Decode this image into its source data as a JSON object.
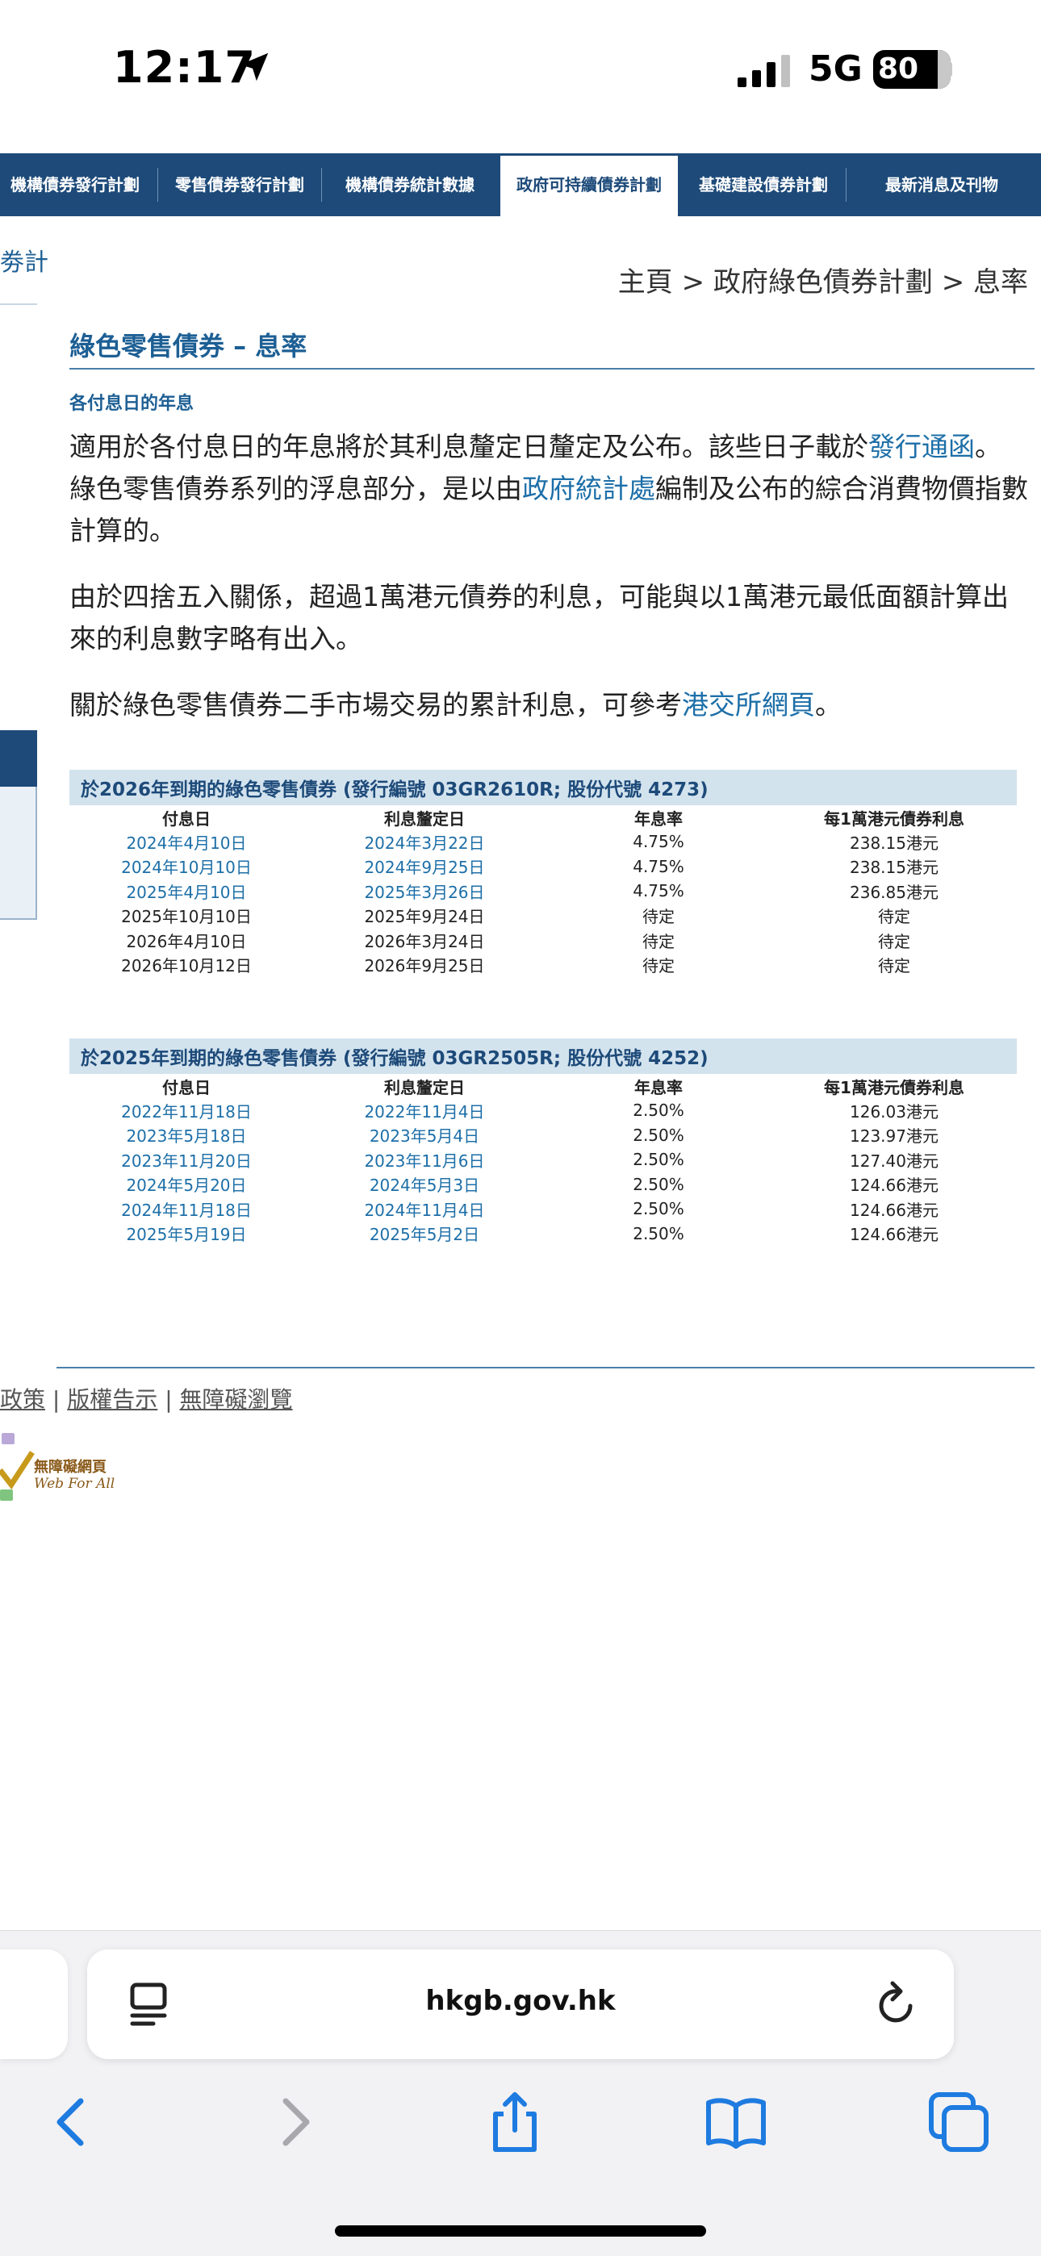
{
  "status_bar": {
    "time": "12:17",
    "network": "5G",
    "battery": "80"
  },
  "nav": {
    "tabs": [
      {
        "label": "機構債券發行計劃",
        "active": false
      },
      {
        "label": "零售債券發行計劃",
        "active": false
      },
      {
        "label": "機構債券統計數據",
        "active": false
      },
      {
        "label": "政府可持續債券計劃",
        "active": true
      },
      {
        "label": "基礎建設債券計劃",
        "active": false
      },
      {
        "label": "最新消息及刊物",
        "active": false
      }
    ]
  },
  "sidebar_fragment": {
    "text": "劵計"
  },
  "breadcrumb": {
    "text": "主頁 > 政府綠色債券計劃 > 息率"
  },
  "page": {
    "title": "綠色零售債券 – 息率",
    "section_title": "各付息日的年息",
    "para1": {
      "t1": "適用於各付息日的年息將於其利息釐定日釐定及公布。該些日子載於",
      "link1": "發行通函",
      "t2": "。 綠色零售債券系列的浮息部分，是以由",
      "link2": "政府統計處",
      "t3": "編制及公布的綜合消費物價指數計算的。"
    },
    "para2": "由於四捨五入關係，超過1萬港元債券的利息，可能與以1萬港元最低面額計算出來的利息數字略有出入。",
    "para3": {
      "t1": "關於綠色零售債券二手市場交易的累計利息，可參考",
      "link1": "港交所網頁",
      "t2": "。"
    }
  },
  "tables": [
    {
      "caption": "於2026年到期的綠色零售債券 (發行編號 03GR2610R; 股份代號 4273)",
      "headers": [
        "付息日",
        "利息釐定日",
        "年息率",
        "每1萬港元債券利息"
      ],
      "rows": [
        {
          "pay": "2024年4月10日",
          "fix": "2024年3月22日",
          "rate": "4.75%",
          "interest": "238.15港元",
          "linked": true
        },
        {
          "pay": "2024年10月10日",
          "fix": "2024年9月25日",
          "rate": "4.75%",
          "interest": "238.15港元",
          "linked": true
        },
        {
          "pay": "2025年4月10日",
          "fix": "2025年3月26日",
          "rate": "4.75%",
          "interest": "236.85港元",
          "linked": true
        },
        {
          "pay": "2025年10月10日",
          "fix": "2025年9月24日",
          "rate": "待定",
          "interest": "待定",
          "linked": false
        },
        {
          "pay": "2026年4月10日",
          "fix": "2026年3月24日",
          "rate": "待定",
          "interest": "待定",
          "linked": false
        },
        {
          "pay": "2026年10月12日",
          "fix": "2026年9月25日",
          "rate": "待定",
          "interest": "待定",
          "linked": false
        }
      ]
    },
    {
      "caption": "於2025年到期的綠色零售債券 (發行編號 03GR2505R; 股份代號 4252)",
      "headers": [
        "付息日",
        "利息釐定日",
        "年息率",
        "每1萬港元債券利息"
      ],
      "rows": [
        {
          "pay": "2022年11月18日",
          "fix": "2022年11月4日",
          "rate": "2.50%",
          "interest": "126.03港元",
          "linked": true
        },
        {
          "pay": "2023年5月18日",
          "fix": "2023年5月4日",
          "rate": "2.50%",
          "interest": "123.97港元",
          "linked": true
        },
        {
          "pay": "2023年11月20日",
          "fix": "2023年11月6日",
          "rate": "2.50%",
          "interest": "127.40港元",
          "linked": true
        },
        {
          "pay": "2024年5月20日",
          "fix": "2024年5月3日",
          "rate": "2.50%",
          "interest": "124.66港元",
          "linked": true
        },
        {
          "pay": "2024年11月18日",
          "fix": "2024年11月4日",
          "rate": "2.50%",
          "interest": "124.66港元",
          "linked": true
        },
        {
          "pay": "2025年5月19日",
          "fix": "2025年5月2日",
          "rate": "2.50%",
          "interest": "124.66港元",
          "linked": true
        }
      ]
    }
  ],
  "footer": {
    "link1": "政策",
    "link2": "版權告示",
    "link3": "無障礙瀏覽",
    "sep": "|",
    "badge_text1": "無障礙網頁",
    "badge_text2": "Web For All"
  },
  "browser": {
    "url": "hkgb.gov.hk"
  },
  "colors": {
    "nav_bg": "#1d4a79",
    "link": "#1d6fa8",
    "caption_bg": "#d3e3ee"
  }
}
